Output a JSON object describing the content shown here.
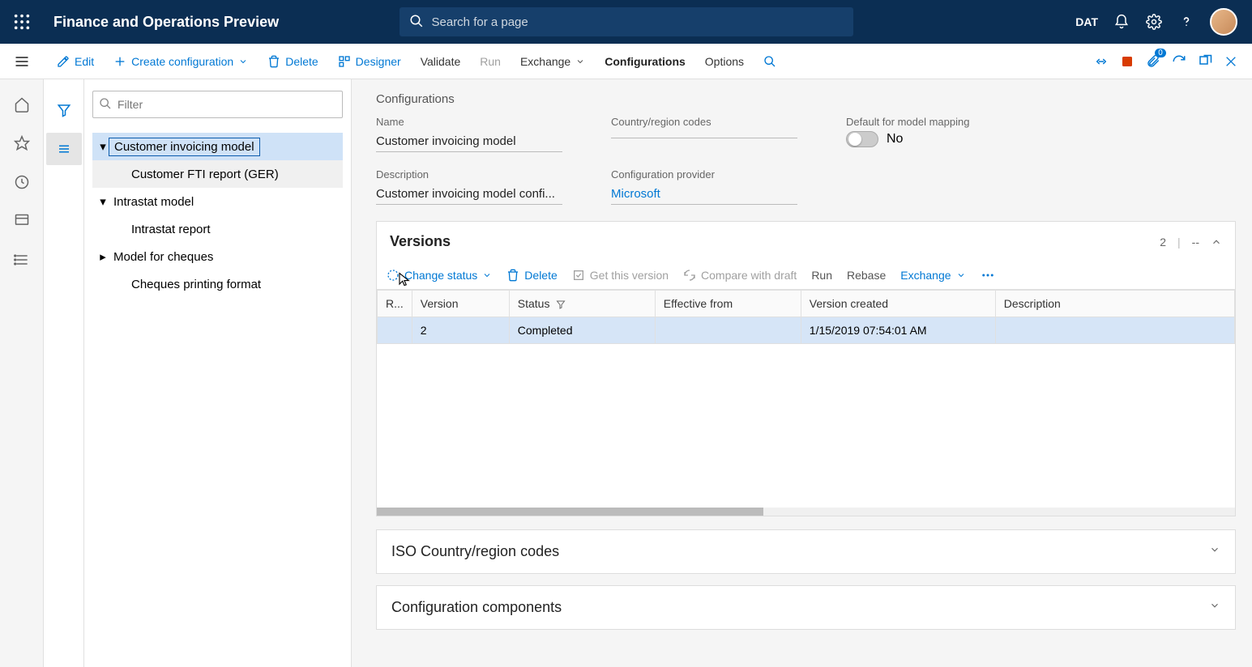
{
  "header": {
    "app_title": "Finance and Operations Preview",
    "search_placeholder": "Search for a page",
    "company": "DAT"
  },
  "actionbar": {
    "edit": "Edit",
    "create": "Create configuration",
    "delete": "Delete",
    "designer": "Designer",
    "validate": "Validate",
    "run": "Run",
    "exchange": "Exchange",
    "configurations": "Configurations",
    "options": "Options",
    "badge": "0"
  },
  "tree": {
    "filter_placeholder": "Filter",
    "items": [
      {
        "label": "Customer invoicing model",
        "expanded": true,
        "selected": true
      },
      {
        "label": "Customer FTI report (GER)",
        "child": true,
        "hover": true
      },
      {
        "label": "Intrastat model",
        "expanded": true
      },
      {
        "label": "Intrastat report",
        "child": true
      },
      {
        "label": "Model for cheques",
        "expanded": true
      },
      {
        "label": "Cheques printing format",
        "child": true
      }
    ]
  },
  "detail": {
    "section_title": "Configurations",
    "name_label": "Name",
    "name_value": "Customer invoicing model",
    "country_label": "Country/region codes",
    "country_value": "",
    "default_label": "Default for model mapping",
    "default_value": "No",
    "desc_label": "Description",
    "desc_value": "Customer invoicing model confi...",
    "provider_label": "Configuration provider",
    "provider_value": "Microsoft"
  },
  "versions": {
    "title": "Versions",
    "count": "2",
    "dash": "--",
    "toolbar": {
      "change_status": "Change status",
      "delete": "Delete",
      "get_version": "Get this version",
      "compare": "Compare with draft",
      "run": "Run",
      "rebase": "Rebase",
      "exchange": "Exchange"
    },
    "columns": {
      "r": "R...",
      "version": "Version",
      "status": "Status",
      "effective": "Effective from",
      "created": "Version created",
      "description": "Description"
    },
    "rows": [
      {
        "r": "",
        "version": "2",
        "status": "Completed",
        "effective": "",
        "created": "1/15/2019 07:54:01 AM",
        "description": ""
      }
    ]
  },
  "collapsed": {
    "iso": "ISO Country/region codes",
    "components": "Configuration components"
  }
}
